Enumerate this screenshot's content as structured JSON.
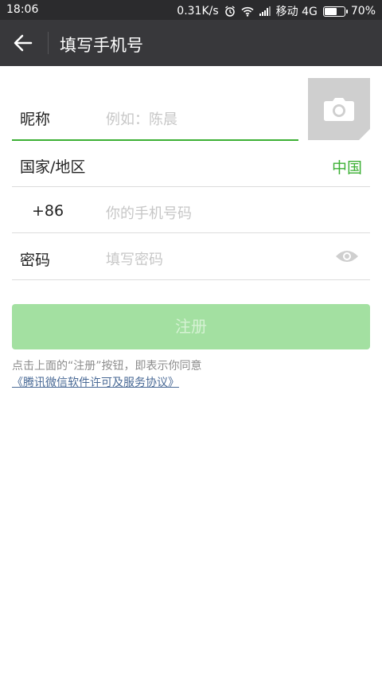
{
  "status_bar": {
    "time": "18:06",
    "speed": "0.31K/s",
    "carrier": "移动 4G",
    "battery": "70%",
    "battery_level": 0.7
  },
  "header": {
    "title": "填写手机号"
  },
  "form": {
    "nickname_label": "昵称",
    "nickname_placeholder": "例如：陈晨",
    "country_label": "国家/地区",
    "country_value": "中国",
    "country_code": "+86",
    "phone_placeholder": "你的手机号码",
    "password_label": "密码",
    "password_placeholder": "填写密码"
  },
  "actions": {
    "register_label": "注册"
  },
  "agreement": {
    "text": "点击上面的“注册”按钮，即表示你同意",
    "link": "《腾讯微信软件许可及服务协议》"
  },
  "colors": {
    "accent_green": "#3cb034",
    "button_disabled": "#a3e0a1",
    "titlebar": "#38383b"
  },
  "icons": [
    "back-arrow-icon",
    "camera-icon",
    "eye-icon",
    "alarm-icon",
    "wifi-icon",
    "signal-icon",
    "battery-icon"
  ]
}
